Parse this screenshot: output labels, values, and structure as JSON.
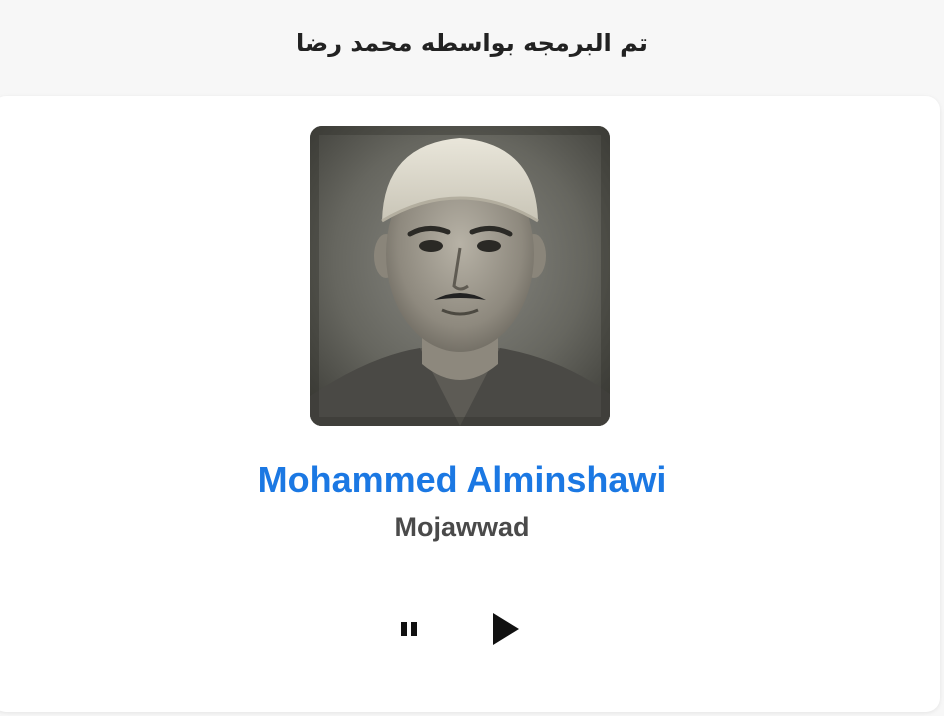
{
  "header": {
    "credit_text": "تم البرمجه بواسطه محمد رضا"
  },
  "player": {
    "reciter_name": "Mohammed Alminshawi",
    "recitation_style": "Mojawwad",
    "photo_alt": "Mohammed Alminshawi",
    "pause_icon": "pause-icon",
    "play_icon": "play-icon"
  },
  "colors": {
    "page_background": "#f7f7f7",
    "card_background": "#ffffff",
    "name_accent": "#1b78e3",
    "subtitle_gray": "#4a4a4a",
    "icon_black": "#111111"
  }
}
